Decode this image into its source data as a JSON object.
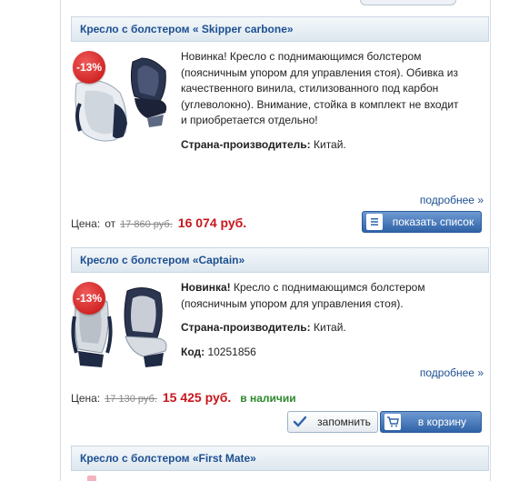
{
  "products": [
    {
      "title": "Кресло с болстером « Skipper carbone»",
      "discount": "-13%",
      "desc_lines": [
        "Новинка! Кресло с поднимающимся болстером",
        "(поясничным упором для управления стоя). Обивка из",
        "качественного винила, стилизованного под карбон",
        "(углеволокно). Внимание, стойка  в комплект не входит",
        "и приобретается отдельно!"
      ],
      "desc_bold_prefix": "",
      "country_label": "Страна-производитель:",
      "country_value": "Китай.",
      "more": "подробнее »",
      "price_label": "Цена:",
      "price_from": "от",
      "old_price": "17 860 руб.",
      "new_price": "16 074 руб.",
      "button": "показать список"
    },
    {
      "title": "Кресло с болстером «Captain»",
      "discount": "-13%",
      "desc_bold_prefix": "Новинка!",
      "desc_lines": [
        " Кресло с поднимающимся болстером",
        "(поясничным упором для управления стоя)."
      ],
      "country_label": "Страна-производитель:",
      "country_value": "Китай.",
      "code_label": "Код:",
      "code_value": "10251856",
      "more": "подробнее »",
      "price_label": "Цена:",
      "old_price": "17 130 руб.",
      "new_price": "15 425 руб.",
      "stock": "в наличии",
      "remember_button": "запомнить",
      "cart_button": "в корзину"
    },
    {
      "title": "Кресло с болстером «First Mate»"
    }
  ],
  "colors": {
    "link": "#1d4f91",
    "price": "#c8161d",
    "stock": "#2d8a2d",
    "badge": "#d42020"
  },
  "icons": [
    "list-icon",
    "checkmark-icon",
    "cart-icon",
    "chair-icon"
  ]
}
